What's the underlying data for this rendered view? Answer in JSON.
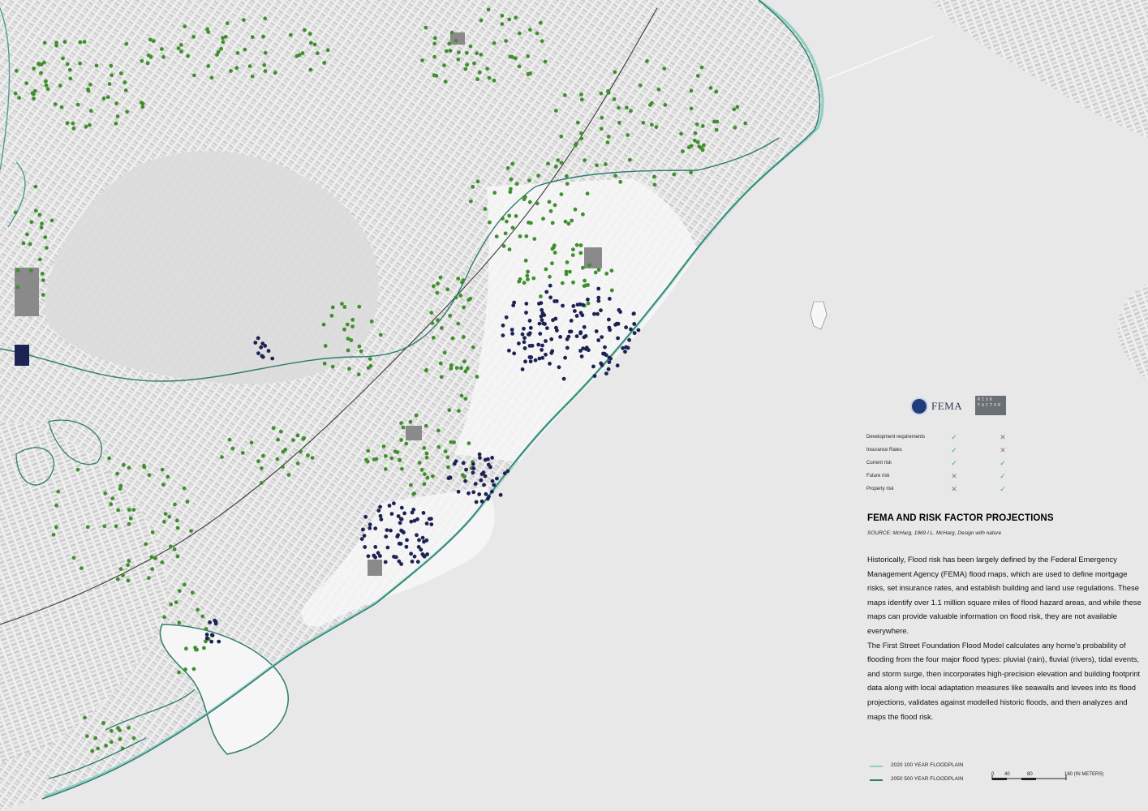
{
  "map": {
    "colors": {
      "water": "#e8e8e8",
      "land": "#f4f4f4",
      "built": "#bdbdbd",
      "floodplain_2020": "#8fcfc1",
      "floodplain_2050": "#2e7d6f",
      "dots_green": "#3f8f2e",
      "dots_navy": "#1c2353"
    }
  },
  "logos": {
    "fema": "FEMA",
    "risk_factor": "RISK FACTOR"
  },
  "comparison": {
    "rows": [
      {
        "label": "Development requirements",
        "fema": "check",
        "risk_factor": "cross"
      },
      {
        "label": "Insurance Rates",
        "fema": "check",
        "risk_factor": "cross"
      },
      {
        "label": "Current risk",
        "fema": "check",
        "risk_factor": "check"
      },
      {
        "label": "Future risk",
        "fema": "cross",
        "risk_factor": "check"
      },
      {
        "label": "Property risk",
        "fema": "cross",
        "risk_factor": "check"
      }
    ],
    "symbols": {
      "check": "✓",
      "cross": "✕"
    }
  },
  "title": "FEMA AND RISK FACTOR PROJECTIONS",
  "source": "SOURCE: McHarg, 1969 I.L. McHarg, Design with nature",
  "body": {
    "p1": "Historically, Flood risk has been largely defined by the Federal Emergency Management Agency (FEMA) flood maps, which are used to define mortgage risks, set insurance rates, and establish building and land use regulations. These maps identify over 1.1 million square miles of flood hazard areas, and while these maps can provide valuable information on flood risk, they are not available everywhere.",
    "p2": "The First Street Foundation Flood Model calculates any home's probability of flooding from the four major flood types: pluvial (rain), fluvial (rivers), tidal events, and storm surge, then incorporates high-precision elevation and building footprint data along with local adaptation measures like seawalls and levees into its flood projections, validates against modelled historic floods, and then analyzes and maps the flood risk."
  },
  "legend": [
    {
      "label": "2020 100 YEAR FLOODPLAIN",
      "color": "#8fcfc1"
    },
    {
      "label": "2050 500 YEAR FLOODPLAIN",
      "color": "#2e7d6f"
    }
  ],
  "scale_bar": {
    "ticks": [
      "0",
      "40",
      "80",
      "160 (IN METERS)"
    ]
  }
}
